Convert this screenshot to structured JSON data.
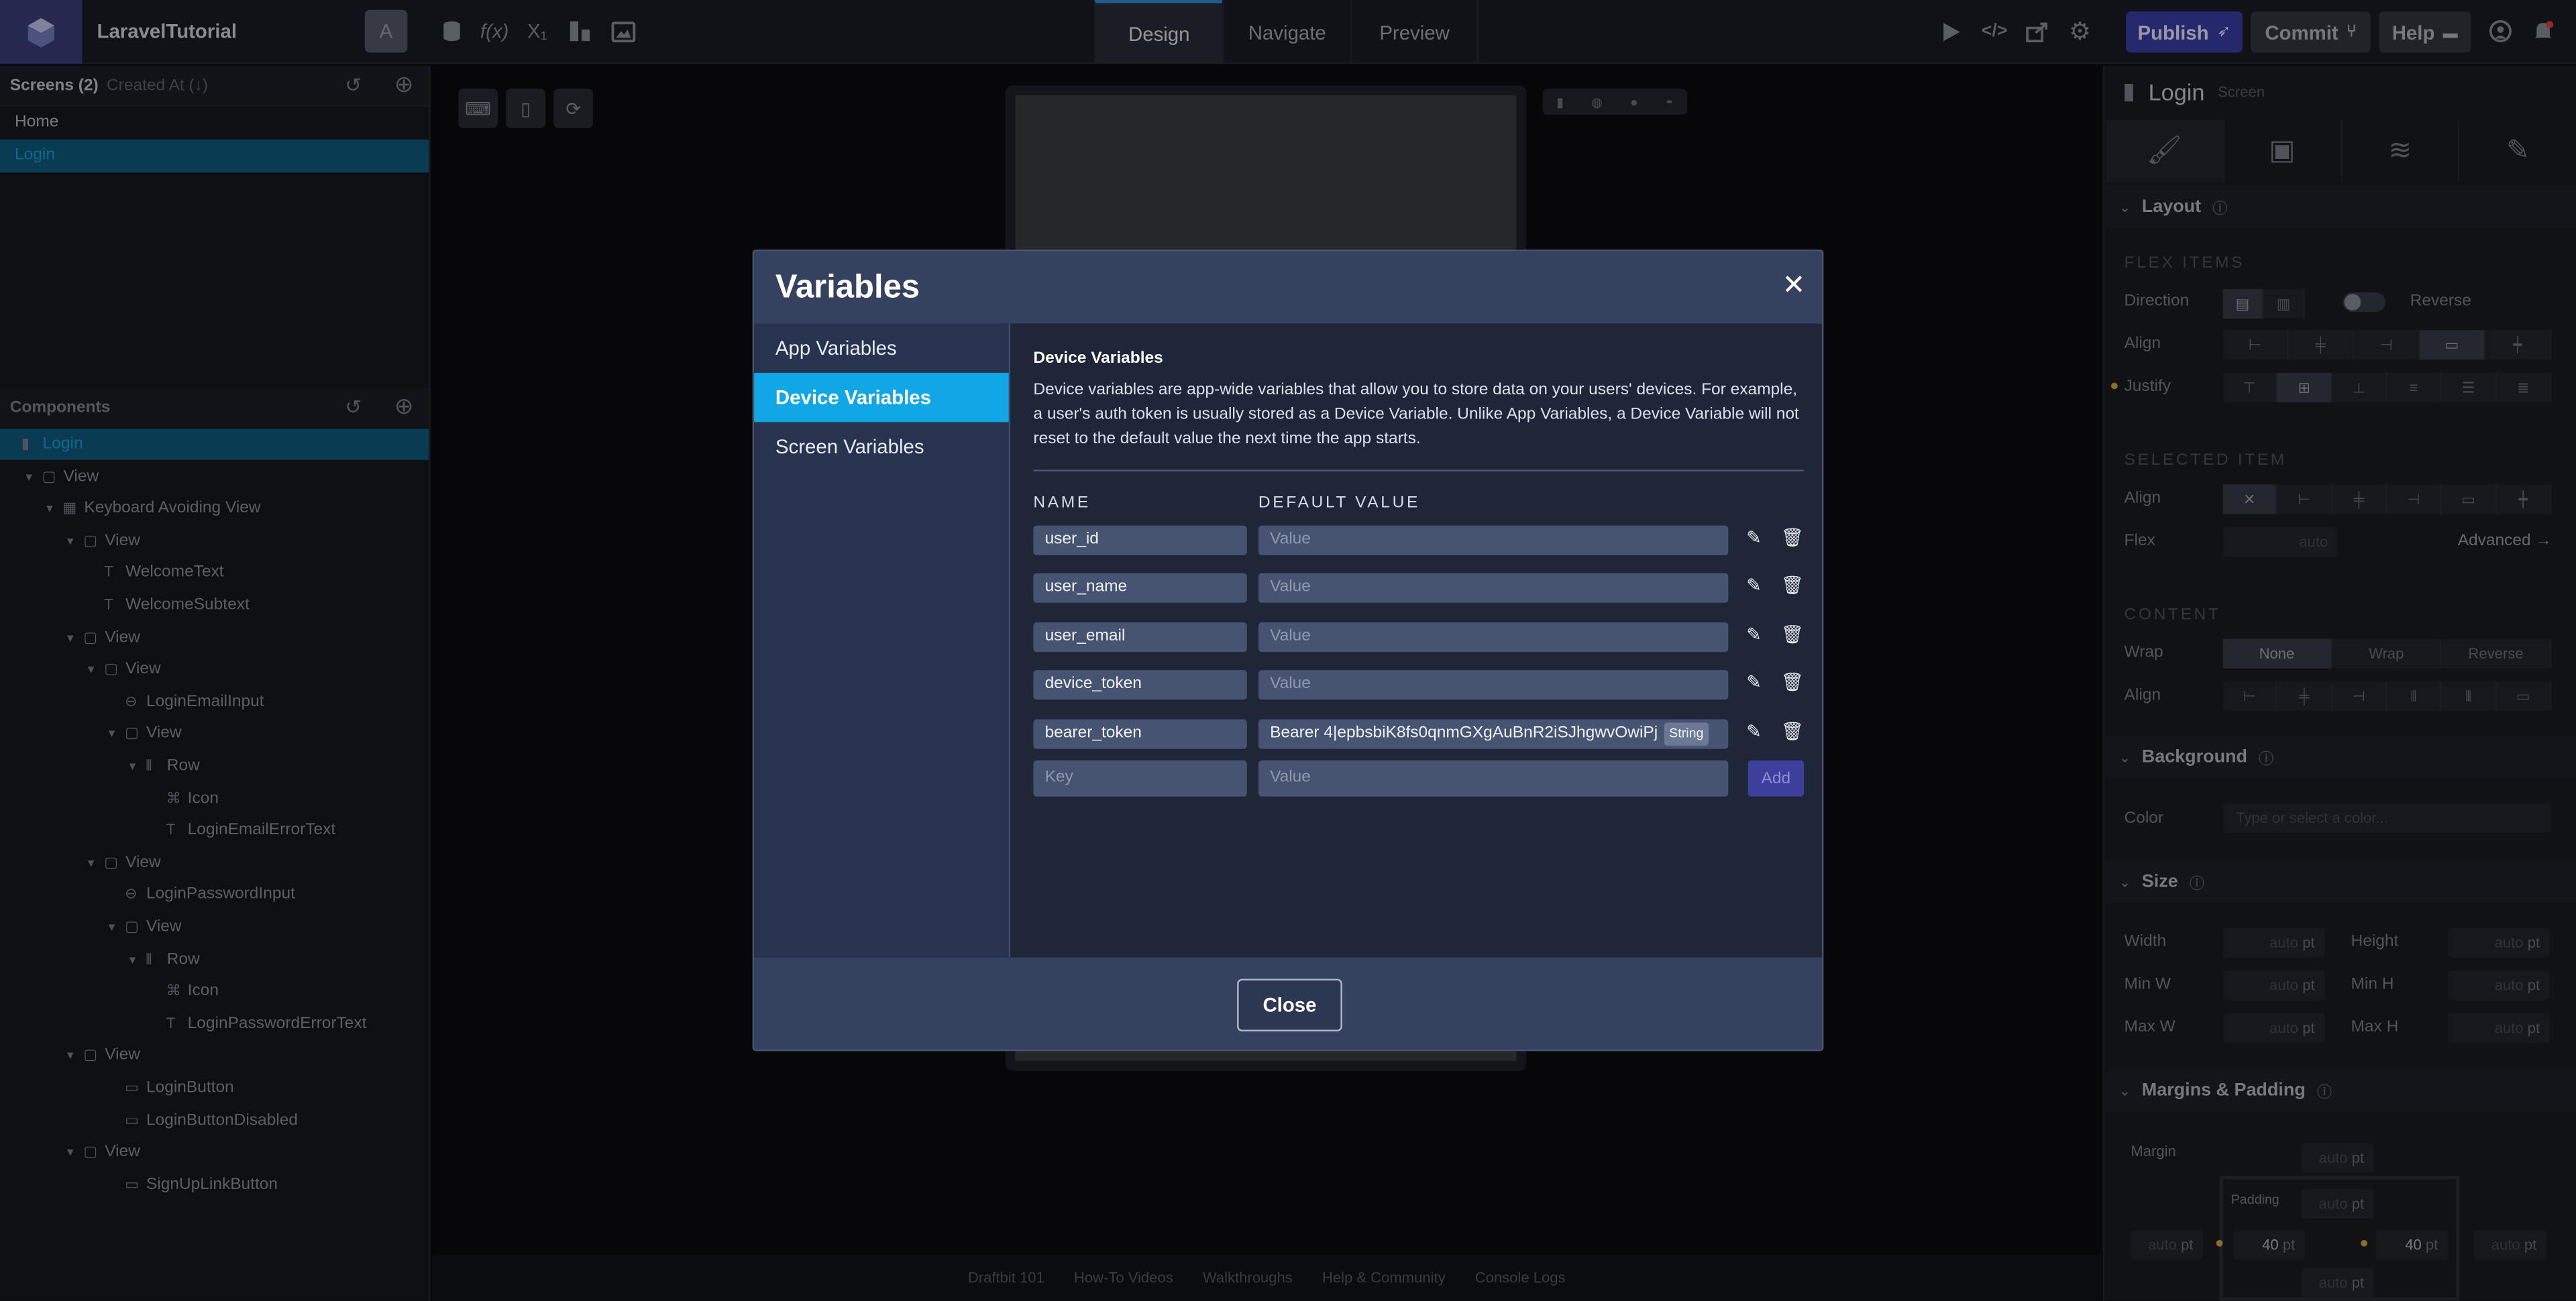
{
  "app": {
    "project_name": "LaravelTutorial",
    "avatar_letter": "A"
  },
  "topbar": {
    "tabs": [
      {
        "label": "Design"
      },
      {
        "label": "Navigate"
      },
      {
        "label": "Preview"
      }
    ],
    "publish_label": "Publish",
    "commit_label": "Commit",
    "help_label": "Help"
  },
  "screens": {
    "header": "Screens (2)",
    "sort": "Created At (↓)",
    "items": [
      {
        "label": "Home"
      },
      {
        "label": "Login"
      }
    ]
  },
  "components": {
    "header": "Components",
    "tree": [
      {
        "label": "Login"
      },
      {
        "label": "View"
      },
      {
        "label": "Keyboard Avoiding View"
      },
      {
        "label": "View"
      },
      {
        "label": "WelcomeText"
      },
      {
        "label": "WelcomeSubtext"
      },
      {
        "label": "View"
      },
      {
        "label": "View"
      },
      {
        "label": "LoginEmailInput"
      },
      {
        "label": "View"
      },
      {
        "label": "Row"
      },
      {
        "label": "Icon"
      },
      {
        "label": "LoginEmailErrorText"
      },
      {
        "label": "View"
      },
      {
        "label": "LoginPasswordInput"
      },
      {
        "label": "View"
      },
      {
        "label": "Row"
      },
      {
        "label": "Icon"
      },
      {
        "label": "LoginPasswordErrorText"
      },
      {
        "label": "View"
      },
      {
        "label": "LoginButton"
      },
      {
        "label": "LoginButtonDisabled"
      },
      {
        "label": "View"
      },
      {
        "label": "SignUpLinkButton"
      }
    ]
  },
  "footer": {
    "links": [
      "Draftbit 101",
      "How-To Videos",
      "Walkthroughs",
      "Help & Community",
      "Console Logs"
    ]
  },
  "right_panel": {
    "title": "Login",
    "subtitle": "Screen",
    "layout": {
      "section": "Layout",
      "flex_items_caption": "FLEX ITEMS",
      "direction_label": "Direction",
      "reverse_label": "Reverse",
      "align_label": "Align",
      "justify_label": "Justify",
      "selected_item_caption": "SELECTED ITEM",
      "flex_label": "Flex",
      "flex_value": "auto",
      "advanced_label": "Advanced →",
      "content_caption": "CONTENT",
      "wrap_label": "Wrap",
      "wrap_options": [
        "None",
        "Wrap",
        "Reverse"
      ]
    },
    "background": {
      "section": "Background",
      "color_label": "Color",
      "color_placeholder": "Type or select a color..."
    },
    "size": {
      "section": "Size",
      "width": "Width",
      "height": "Height",
      "min_w": "Min W",
      "min_h": "Min H",
      "max_w": "Max W",
      "max_h": "Max H",
      "value": "auto",
      "unit": "pt"
    },
    "margins": {
      "section": "Margins & Padding",
      "margin_label": "Margin",
      "padding_label": "Padding",
      "auto": "auto",
      "padding_left": "40",
      "padding_right": "40",
      "unit": "pt"
    }
  },
  "modal": {
    "title": "Variables",
    "nav": [
      {
        "label": "App Variables"
      },
      {
        "label": "Device Variables"
      },
      {
        "label": "Screen Variables"
      }
    ],
    "section_title": "Device Variables",
    "description": "Device variables are app-wide variables that allow you to store data on your users' devices. For example, a user's auth token is usually stored as a Device Variable. Unlike App Variables, a Device Variable will not reset to the default value the next time the app starts.",
    "col_name": "NAME",
    "col_default": "DEFAULT VALUE",
    "value_placeholder": "Value",
    "key_placeholder": "Key",
    "variables": [
      {
        "name": "user_id",
        "value": ""
      },
      {
        "name": "user_name",
        "value": ""
      },
      {
        "name": "user_email",
        "value": ""
      },
      {
        "name": "device_token",
        "value": ""
      },
      {
        "name": "bearer_token",
        "value": "Bearer 4|epbsbiK8fs0qnmGXgAuBnR2iSJhgwvOwiPj",
        "type": "String"
      }
    ],
    "add_label": "Add",
    "close_label": "Close"
  }
}
